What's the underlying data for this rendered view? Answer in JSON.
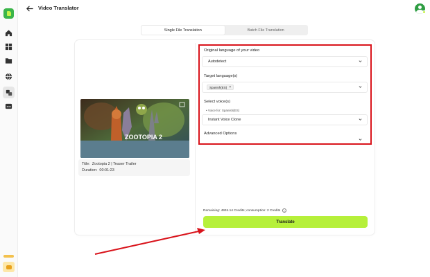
{
  "header": {
    "title": "Video Translator",
    "back_icon": "arrow-left-icon"
  },
  "sidebar": {
    "items": [
      {
        "name": "home",
        "icon": "home-icon"
      },
      {
        "name": "grid",
        "icon": "grid-icon"
      },
      {
        "name": "folder",
        "icon": "folder-icon"
      },
      {
        "name": "globe",
        "icon": "globe-icon"
      },
      {
        "name": "translate",
        "icon": "translate-icon",
        "active": true
      },
      {
        "name": "subtitles",
        "icon": "subtitle-icon"
      }
    ]
  },
  "tabs": [
    {
      "label": "Single File Translation",
      "active": true
    },
    {
      "label": "Batch File Translation",
      "active": false
    }
  ],
  "video": {
    "title_label": "Title:",
    "title_value": "Zootopia 2 | Teaser Trailer",
    "duration_label": "Duration:",
    "duration_value": "00:01:23",
    "thumb_text": "ZOOTOPIA 2"
  },
  "form": {
    "original_language": {
      "label": "Original language of your video",
      "value": "Autodetect"
    },
    "target_language": {
      "label": "Target language(s)",
      "chip": "Spanish(ES)",
      "chip_remove": "×"
    },
    "voice": {
      "label": "Select voice(s)",
      "voice_for": "Voice for: Spanish(ES)",
      "value": "Instant Voice Clone"
    },
    "advanced_label": "Advanced Options"
  },
  "footer": {
    "remaining": "Remaining: 4934.14 Credits; consumption: 2 Credits",
    "info_glyph": "i",
    "translate_label": "Translate"
  },
  "colors": {
    "accent_green": "#b6f03a",
    "brand_green": "#3bb54a",
    "highlight_red": "#d9131b"
  }
}
